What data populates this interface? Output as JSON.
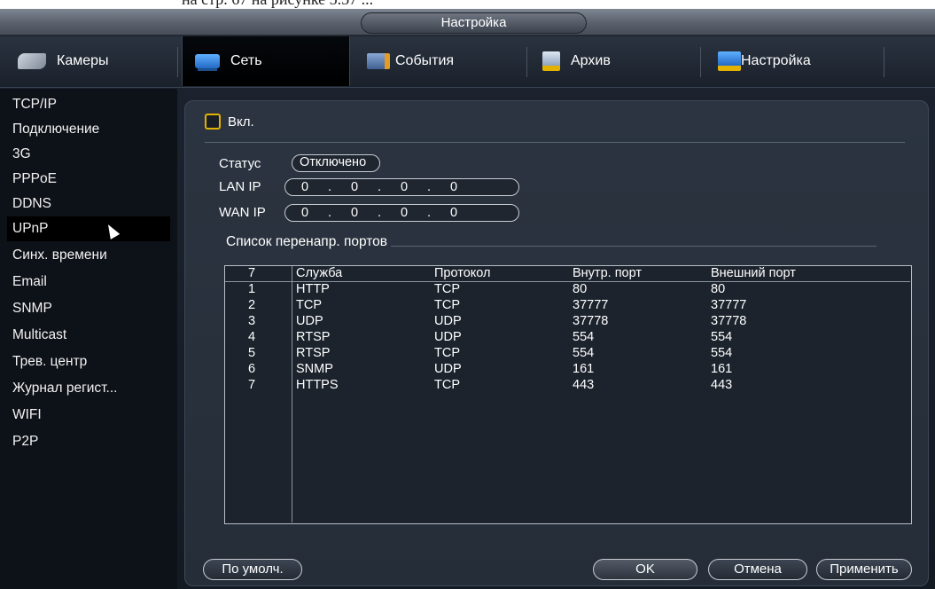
{
  "caption_text": "на стр. 67 на рисунке 5.57 ...",
  "window": {
    "title": "Настройка"
  },
  "tabs": [
    {
      "label": "Камеры",
      "icon": "camera-icon"
    },
    {
      "label": "Сеть",
      "icon": "network-icon",
      "active": true
    },
    {
      "label": "События",
      "icon": "events-icon"
    },
    {
      "label": "Архив",
      "icon": "archive-icon"
    },
    {
      "label": "Настройка",
      "icon": "settings-icon"
    }
  ],
  "sidebar": {
    "items": [
      {
        "label": "TCP/IP"
      },
      {
        "label": "Подключение"
      },
      {
        "label": "3G"
      },
      {
        "label": "PPPoE"
      },
      {
        "label": "DDNS"
      },
      {
        "label": "UPnP",
        "selected": true
      },
      {
        "label": "Синх. времени"
      },
      {
        "label": "Email"
      },
      {
        "label": "SNMP"
      },
      {
        "label": "Multicast"
      },
      {
        "label": "Трев. центр"
      },
      {
        "label": "Журнал регист..."
      },
      {
        "label": "WIFI"
      },
      {
        "label": "P2P"
      }
    ]
  },
  "upnp": {
    "enable_label": "Вкл.",
    "enabled": false,
    "status_label": "Статус",
    "status_value": "Отключено",
    "lan_ip_label": "LAN IP",
    "lan_ip": [
      "0",
      "0",
      "0",
      "0"
    ],
    "wan_ip_label": "WAN IP",
    "wan_ip": [
      "0",
      "0",
      "0",
      "0"
    ],
    "port_list_title": "Список перенапр. портов"
  },
  "table": {
    "columns": [
      "7",
      "Служба",
      "Протокол",
      "Внутр. порт",
      "Внешний порт"
    ],
    "rows": [
      [
        "1",
        "HTTP",
        "TCP",
        "80",
        "80"
      ],
      [
        "2",
        "TCP",
        "TCP",
        "37777",
        "37777"
      ],
      [
        "3",
        "UDP",
        "UDP",
        "37778",
        "37778"
      ],
      [
        "4",
        "RTSP",
        "UDP",
        "554",
        "554"
      ],
      [
        "5",
        "RTSP",
        "TCP",
        "554",
        "554"
      ],
      [
        "6",
        "SNMP",
        "UDP",
        "161",
        "161"
      ],
      [
        "7",
        "HTTPS",
        "TCP",
        "443",
        "443"
      ]
    ]
  },
  "footer": {
    "default_label": "По умолч.",
    "ok_label": "OK",
    "cancel_label": "Отмена",
    "apply_label": "Применить"
  },
  "colors": {
    "checkbox_border": "#e3b200",
    "panel_bg": "#2b3440",
    "selected_bg": "#000000"
  }
}
